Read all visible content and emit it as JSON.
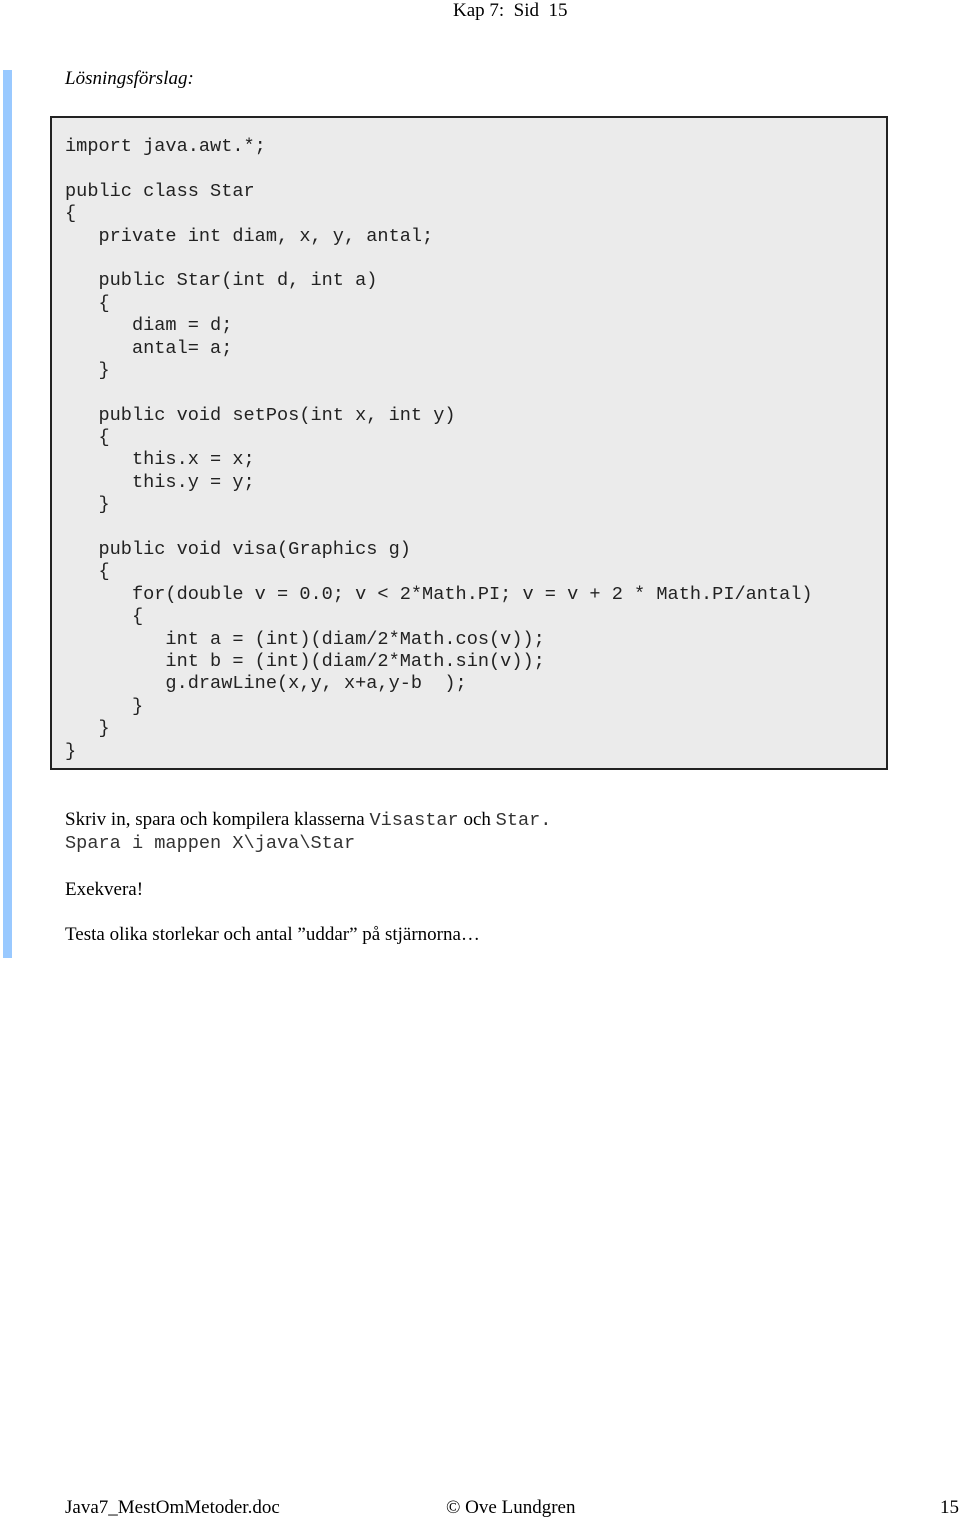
{
  "header": {
    "text": "Kap 7:  Sid  15"
  },
  "subtitle": "Lösningsförslag:",
  "code": {
    "lines": [
      "import java.awt.*;",
      "",
      "public class Star",
      "{",
      "   private int diam, x, y, antal;",
      "",
      "   public Star(int d, int a)",
      "   {",
      "      diam = d;",
      "      antal= a;",
      "   }",
      "",
      "   public void setPos(int x, int y)",
      "   {",
      "      this.x = x;",
      "      this.y = y;",
      "   }",
      "",
      "   public void visa(Graphics g)",
      "   {",
      "      for(double v = 0.0; v < 2*Math.PI; v = v + 2 * Math.PI/antal)",
      "      {",
      "         int a = (int)(diam/2*Math.cos(v));",
      "         int b = (int)(diam/2*Math.sin(v));",
      "         g.drawLine(x,y, x+a,y-b  );",
      "      }",
      "   }",
      "}"
    ]
  },
  "instructions": {
    "line1_text": "Skriv in, spara och kompilera klasserna ",
    "line1_class1": "Visastar",
    "line1_and": " och ",
    "line1_class2": "Star.",
    "line2": "Spara i mappen X\\java\\Star",
    "execute": "Exekvera!",
    "test": "Testa olika storlekar och antal ”uddar” på stjärnorna…"
  },
  "footer": {
    "filename": "Java7_MestOmMetoder.doc",
    "author": "© Ove Lundgren",
    "page": "15"
  }
}
